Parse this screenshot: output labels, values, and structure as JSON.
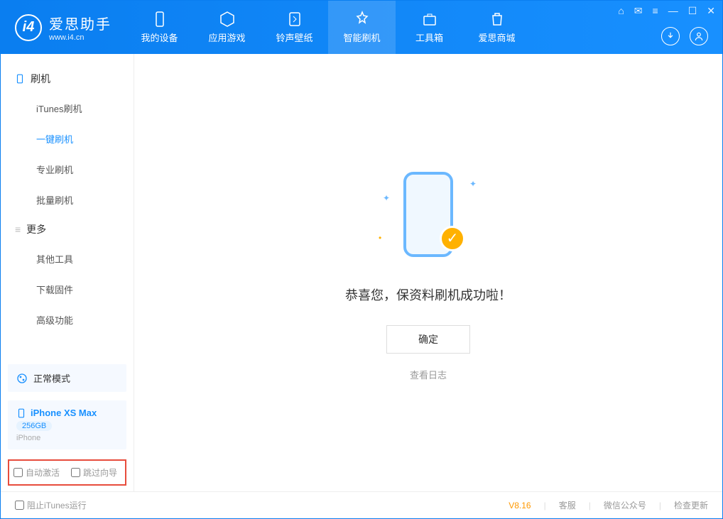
{
  "app": {
    "title": "爱思助手",
    "subtitle": "www.i4.cn"
  },
  "nav": {
    "device": "我的设备",
    "apps": "应用游戏",
    "ringtone": "铃声壁纸",
    "flash": "智能刷机",
    "toolbox": "工具箱",
    "store": "爱思商城"
  },
  "sidebar": {
    "group1": {
      "title": "刷机",
      "items": [
        "iTunes刷机",
        "一键刷机",
        "专业刷机",
        "批量刷机"
      ]
    },
    "group2": {
      "title": "更多",
      "items": [
        "其他工具",
        "下载固件",
        "高级功能"
      ]
    },
    "mode": "正常模式",
    "device": {
      "name": "iPhone XS Max",
      "storage": "256GB",
      "type": "iPhone"
    },
    "check_activate": "自动激活",
    "check_skip": "跳过向导"
  },
  "main": {
    "message": "恭喜您，保资料刷机成功啦！",
    "ok": "确定",
    "log": "查看日志"
  },
  "footer": {
    "block_itunes": "阻止iTunes运行",
    "version": "V8.16",
    "service": "客服",
    "wechat": "微信公众号",
    "update": "检查更新"
  }
}
